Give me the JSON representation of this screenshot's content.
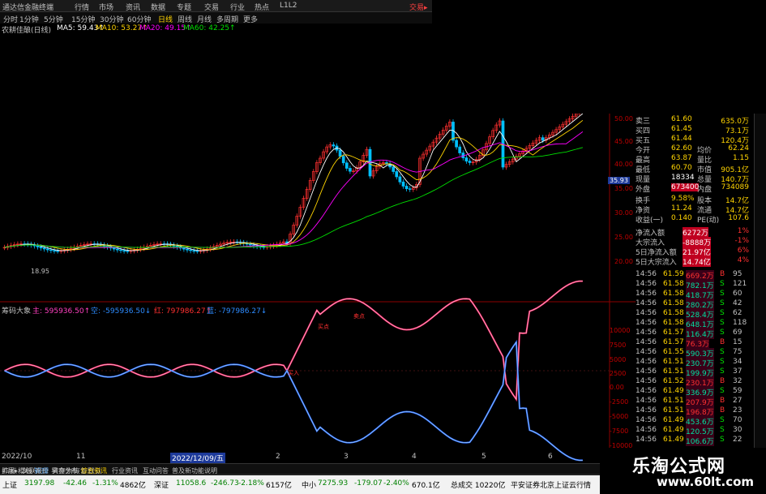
{
  "topbar": {
    "title": "通达信金融终端",
    "menu": [
      "行情",
      "市场",
      "资讯",
      "数据",
      "专题",
      "交易",
      "行业",
      "热点",
      "L1L2"
    ],
    "right": "交易▸"
  },
  "timeframes": [
    "分时",
    "1分钟",
    "5分钟",
    "15分钟",
    "30分钟",
    "60分钟",
    "日线",
    "周线",
    "月线",
    "多周期",
    "更多"
  ],
  "ma": {
    "label": "农耕佳酿(日线)",
    "items": [
      {
        "text": "MA5: 59.43↑",
        "color": "#ffffff"
      },
      {
        "text": "MA10: 53.27↑",
        "color": "#ffd400"
      },
      {
        "text": "MA20: 49.15↑",
        "color": "#ff00ff"
      },
      {
        "text": "MA60: 42.25↑",
        "color": "#00e000"
      }
    ]
  },
  "price_axis": [
    "50.00",
    "45.00",
    "40.00",
    "35.00",
    "30.00",
    "25.00",
    "20.00"
  ],
  "price_marker": "35.93",
  "low_label": "18.95",
  "indicator": {
    "title": "筹码大象",
    "legend": [
      "主: 595936.50↑",
      "空: -595936.50↓",
      "红: 797986.27↑",
      "蓝: -797986.27↓"
    ],
    "axis": [
      "10000",
      "7500",
      "5000",
      "2500",
      "0.00",
      "-2500",
      "-5000",
      "-7500",
      "-10000"
    ],
    "labels": [
      "买入",
      "买点",
      "卖点"
    ]
  },
  "date_axis": {
    "left": "2022/10",
    "ticks": [
      "11",
      "2022/12/09/五",
      "2",
      "3",
      "4",
      "5",
      "6"
    ],
    "highlight": "2022/12/09/五"
  },
  "quote": {
    "rows": [
      {
        "k": "卖三",
        "v": "61.60",
        "r": "635.0万"
      },
      {
        "k": "买四",
        "v": "61.45",
        "r": "73.1万"
      },
      {
        "k": "买五",
        "v": "61.44",
        "r": "120.4万"
      },
      {
        "k": "今开",
        "v": "62.60",
        "k2": "均价",
        "r": "62.24"
      },
      {
        "k": "最高",
        "v": "63.87",
        "k2": "量比",
        "r": "1.15"
      },
      {
        "k": "最低",
        "v": "60.70",
        "k2": "市值",
        "r": "905.1亿"
      },
      {
        "k": "现量",
        "v": "18334",
        "k2": "总量",
        "r": "140.7万"
      },
      {
        "k": "外盘",
        "v": "673400",
        "k2": "内盘",
        "r": "734089"
      },
      {
        "k": "换手",
        "v": "9.58%",
        "k2": "股本",
        "r": "14.7亿"
      },
      {
        "k": "净资",
        "v": "11.24",
        "k2": "流通",
        "r": "14.7亿"
      },
      {
        "k": "收益(一)",
        "v": "0.140",
        "k2": "PE(动)",
        "r": "107.6"
      },
      {
        "k": "净流入额",
        "v": "6272万",
        "r": "1%"
      },
      {
        "k": "大宗流入",
        "v": "-8888万",
        "r": "-1%"
      },
      {
        "k": "5日净流入额",
        "v": "21.97亿",
        "r": "6%"
      },
      {
        "k": "5日大宗流入",
        "v": "14.74亿",
        "r": "4%"
      }
    ]
  },
  "ticks": [
    {
      "t": "14:56",
      "p": "61.59",
      "v": "669.2万",
      "d": "B",
      "n": "95"
    },
    {
      "t": "14:56",
      "p": "61.58",
      "v": "782.1万",
      "d": "S",
      "n": "121"
    },
    {
      "t": "14:56",
      "p": "61.58",
      "v": "418.7万",
      "d": "S",
      "n": "60"
    },
    {
      "t": "14:56",
      "p": "61.58",
      "v": "280.2万",
      "d": "S",
      "n": "42"
    },
    {
      "t": "14:56",
      "p": "61.58",
      "v": "528.4万",
      "d": "S",
      "n": "62"
    },
    {
      "t": "14:56",
      "p": "61.58",
      "v": "648.1万",
      "d": "S",
      "n": "118"
    },
    {
      "t": "14:56",
      "p": "61.57",
      "v": "116.4万",
      "d": "S",
      "n": "69"
    },
    {
      "t": "14:56",
      "p": "61.57",
      "v": "76.3万",
      "d": "B",
      "n": "15"
    },
    {
      "t": "14:56",
      "p": "61.55",
      "v": "590.3万",
      "d": "S",
      "n": "75"
    },
    {
      "t": "14:56",
      "p": "61.51",
      "v": "230.7万",
      "d": "S",
      "n": "34"
    },
    {
      "t": "14:56",
      "p": "61.51",
      "v": "199.9万",
      "d": "S",
      "n": "37"
    },
    {
      "t": "14:56",
      "p": "61.52",
      "v": "230.1万",
      "d": "B",
      "n": "32"
    },
    {
      "t": "14:56",
      "p": "61.49",
      "v": "336.9万",
      "d": "S",
      "n": "59"
    },
    {
      "t": "14:56",
      "p": "61.51",
      "v": "207.9万",
      "d": "B",
      "n": "27"
    },
    {
      "t": "14:56",
      "p": "61.51",
      "v": "196.8万",
      "d": "B",
      "n": "23"
    },
    {
      "t": "14:56",
      "p": "61.49",
      "v": "453.6万",
      "d": "S",
      "n": "70"
    },
    {
      "t": "14:56",
      "p": "61.49",
      "v": "120.5万",
      "d": "S",
      "n": "30"
    },
    {
      "t": "14:56",
      "p": "61.49",
      "v": "106.6万",
      "d": "S",
      "n": "22"
    }
  ],
  "bottom_tabs": [
    "指标",
    "模板",
    "管理",
    "另存为",
    "恢复默认"
  ],
  "bottom_tabs2": [
    "扩展▸",
    "关联报价",
    "资金分布",
    "综合资讯",
    "行业资讯",
    "互动问答",
    "普及新功能说明"
  ],
  "status": [
    {
      "name": "上证",
      "val": "3197.98",
      "chg": "-42.46",
      "pct": "-1.31%",
      "amt": "4862亿"
    },
    {
      "name": "深证",
      "val": "11058.6",
      "chg": "-246.73",
      "pct": "-2.18%",
      "amt": "6157亿"
    },
    {
      "name": "中小",
      "val": "7275.93",
      "chg": "-179.07",
      "pct": "-2.40%",
      "amt": "670.1亿"
    }
  ],
  "status_right": "总成交  10220亿",
  "status_news": "平安证券北京上证云行情",
  "watermark": {
    "cn": "乐淘公式网",
    "url": "www.60lt.com"
  },
  "colors": {
    "up": "#ff3030",
    "down": "#00c0ff",
    "ma5": "#ffffff",
    "ma10": "#ffd400",
    "ma20": "#ff00ff",
    "ma60": "#00e000",
    "pink": "#ff2d6e",
    "blue": "#2d6bff"
  }
}
